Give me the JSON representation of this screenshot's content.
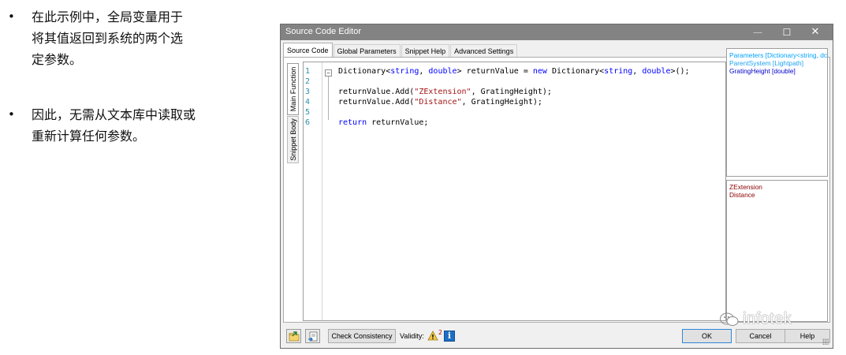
{
  "bullets": [
    {
      "marker": "•",
      "text": "在此示例中，全局变量用于\n将其值返回到系统的两个选\n定参数。"
    },
    {
      "marker": "•",
      "text": "因此，无需从文本库中读取或\n重新计算任何参数。"
    }
  ],
  "window": {
    "title": "Source Code Editor",
    "controls": {
      "minimize": "—",
      "maximize": "☐",
      "close": "✕"
    }
  },
  "tabs": [
    "Source Code",
    "Global Parameters",
    "Snippet Help",
    "Advanced Settings"
  ],
  "active_tab": "Source Code",
  "side_tabs": [
    "Main Function",
    "Snippet Body"
  ],
  "editor": {
    "line_numbers": [
      "1",
      "2",
      "3",
      "4",
      "5",
      "6"
    ],
    "fold_marker": "−",
    "lines": [
      [
        {
          "t": "Dictionary<",
          "c": "plain"
        },
        {
          "t": "string",
          "c": "kw"
        },
        {
          "t": ", ",
          "c": "plain"
        },
        {
          "t": "double",
          "c": "kw"
        },
        {
          "t": "> returnValue = ",
          "c": "plain"
        },
        {
          "t": "new",
          "c": "kw"
        },
        {
          "t": " Dictionary<",
          "c": "plain"
        },
        {
          "t": "string",
          "c": "kw"
        },
        {
          "t": ", ",
          "c": "plain"
        },
        {
          "t": "double",
          "c": "kw"
        },
        {
          "t": ">();",
          "c": "plain"
        }
      ],
      [],
      [
        {
          "t": "returnValue.Add(",
          "c": "plain"
        },
        {
          "t": "\"ZExtension\"",
          "c": "str"
        },
        {
          "t": ", GratingHeight);",
          "c": "plain"
        }
      ],
      [
        {
          "t": "returnValue.Add(",
          "c": "plain"
        },
        {
          "t": "\"Distance\"",
          "c": "str"
        },
        {
          "t": ", GratingHeight);",
          "c": "plain"
        }
      ],
      [],
      [
        {
          "t": "return",
          "c": "kw"
        },
        {
          "t": " returnValue;",
          "c": "plain"
        }
      ]
    ]
  },
  "parameter_list": [
    "Parameters [Dictionary<string, dc",
    "ParentSystem [Lightpath]",
    "GratingHeight [double]"
  ],
  "value_list": [
    "ZExtension",
    "Distance"
  ],
  "toolbar": {
    "check_consistency": "Check Consistency",
    "validity_label": "Validity:",
    "warning_count": "2",
    "info_icon_glyph": "i",
    "ok": "OK",
    "cancel": "Cancel",
    "help": "Help"
  },
  "watermark": {
    "text": "infotek"
  },
  "colors": {
    "titlebar": "#838383",
    "keyword": "#0000ff",
    "string": "#a31515",
    "line_number": "#2b91af",
    "param_light": "#00a2ff",
    "param_dark": "#0000cc",
    "value_item": "#8b0000",
    "ok_border": "#2f86d6",
    "info_icon": "#1e6fc2",
    "warning_icon": "#f2c94c"
  }
}
